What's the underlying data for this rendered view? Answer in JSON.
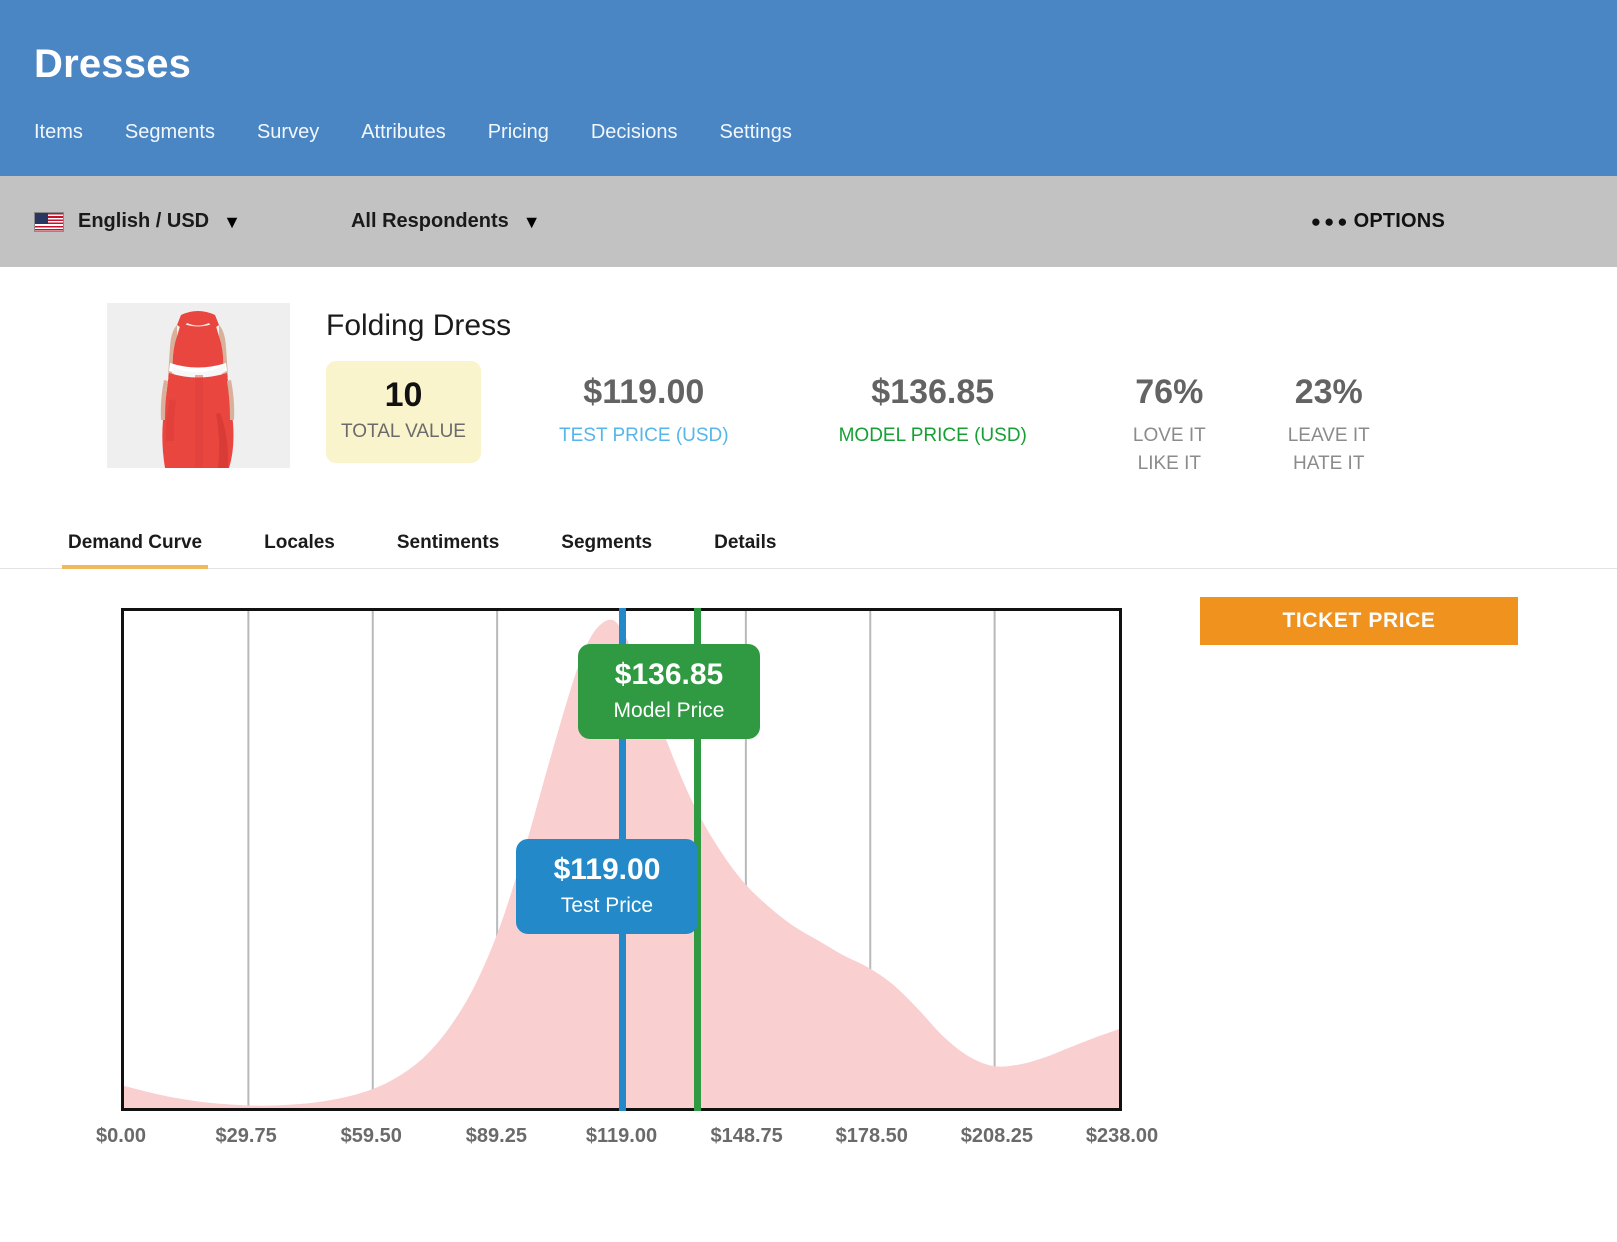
{
  "header": {
    "title": "Dresses",
    "nav": [
      {
        "label": "Items"
      },
      {
        "label": "Segments"
      },
      {
        "label": "Survey"
      },
      {
        "label": "Attributes"
      },
      {
        "label": "Pricing"
      },
      {
        "label": "Decisions"
      },
      {
        "label": "Settings"
      }
    ]
  },
  "toolbar": {
    "locale": "English / USD",
    "locale_caret": "▼",
    "respondents": "All Respondents",
    "respondents_caret": "▼",
    "options_dots": "●●●",
    "options_label": "OPTIONS",
    "flag_icon": "us-flag-icon"
  },
  "product": {
    "name": "Folding Dress",
    "total_value": {
      "value": "10",
      "caption": "TOTAL VALUE"
    },
    "metrics": [
      {
        "value": "$119.00",
        "caption": "TEST PRICE (USD)",
        "color": "#54b6ea"
      },
      {
        "value": "$136.85",
        "caption": "MODEL PRICE (USD)",
        "color": "#16a034"
      },
      {
        "value": "76%",
        "caption_line1": "LOVE IT",
        "caption_line2": "LIKE IT",
        "color": "#8b8b8b"
      },
      {
        "value": "23%",
        "caption_line1": "LEAVE IT",
        "caption_line2": "HATE IT",
        "color": "#8b8b8b"
      }
    ]
  },
  "tabs": [
    {
      "label": "Demand Curve",
      "active": true
    },
    {
      "label": "Locales",
      "active": false
    },
    {
      "label": "Sentiments",
      "active": false
    },
    {
      "label": "Segments",
      "active": false
    },
    {
      "label": "Details",
      "active": false
    }
  ],
  "actions": {
    "ticket_price": "TICKET PRICE"
  },
  "callouts": {
    "model": {
      "price": "$136.85",
      "label": "Model Price"
    },
    "test": {
      "price": "$119.00",
      "label": "Test Price"
    }
  },
  "chart_data": {
    "type": "area",
    "title": "Demand Curve",
    "xlabel": "",
    "ylabel": "",
    "xlim": [
      0,
      238
    ],
    "grid": true,
    "legend_position": "none",
    "area_color": "#f9cfd0",
    "tick_labels": [
      "$0.00",
      "$29.75",
      "$59.50",
      "$89.25",
      "$119.00",
      "$148.75",
      "$178.50",
      "$208.25",
      "$238.00"
    ],
    "tick_values": [
      0,
      29.75,
      59.5,
      89.25,
      119,
      148.75,
      178.5,
      208.25,
      238
    ],
    "markers": [
      {
        "name": "Test Price",
        "value": 119,
        "color": "#2389c8"
      },
      {
        "name": "Model Price",
        "value": 136.85,
        "color": "#2f9a41"
      }
    ],
    "x": [
      0,
      6,
      12,
      18,
      24,
      30,
      36,
      42,
      48,
      54,
      60,
      66,
      72,
      78,
      84,
      90,
      96,
      102,
      108,
      112,
      116,
      119,
      124,
      130,
      136,
      142,
      148,
      154,
      160,
      166,
      172,
      178,
      184,
      190,
      196,
      202,
      208,
      214,
      220,
      226,
      232,
      238
    ],
    "y": [
      4.5,
      3.2,
      2.1,
      1.3,
      0.8,
      0.5,
      0.5,
      0.8,
      1.4,
      2.4,
      4.0,
      6.6,
      10.5,
      16.5,
      25.0,
      37.0,
      53.0,
      71.0,
      88.0,
      96.0,
      99.0,
      97.0,
      88.0,
      74.0,
      62.0,
      53.0,
      46.0,
      41.0,
      37.0,
      34.0,
      31.0,
      28.5,
      25.0,
      20.0,
      14.5,
      10.5,
      8.5,
      8.8,
      10.2,
      12.2,
      14.2,
      16.0
    ],
    "ylim": [
      0,
      100
    ]
  }
}
